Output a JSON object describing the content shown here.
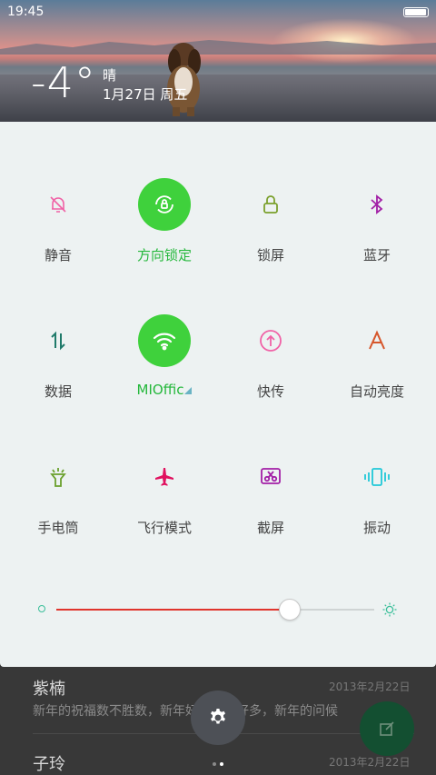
{
  "statusbar": {
    "time": "19:45",
    "battery_level": 0.95
  },
  "weather": {
    "temperature": "-4°",
    "condition": "晴",
    "date": "1月27日 周五"
  },
  "toggles": [
    {
      "label": "静音",
      "icon": "bell-mute-icon",
      "active": false,
      "color": "#f062a6"
    },
    {
      "label": "方向锁定",
      "icon": "rotation-lock-icon",
      "active": true,
      "color": "#ffffff"
    },
    {
      "label": "锁屏",
      "icon": "lock-icon",
      "active": false,
      "color": "#7aa02c"
    },
    {
      "label": "蓝牙",
      "icon": "bluetooth-icon",
      "active": false,
      "color": "#a21fa6"
    },
    {
      "label": "数据",
      "icon": "data-arrows-icon",
      "active": false,
      "color": "#1f7a6a"
    },
    {
      "label": "MIOffic",
      "icon": "wifi-icon",
      "active": true,
      "color": "#ffffff"
    },
    {
      "label": "快传",
      "icon": "upload-circle-icon",
      "active": false,
      "color": "#f062a6"
    },
    {
      "label": "自动亮度",
      "icon": "auto-brightness-icon",
      "active": false,
      "color": "#d6562b"
    },
    {
      "label": "手电筒",
      "icon": "flashlight-icon",
      "active": false,
      "color": "#6aa02c"
    },
    {
      "label": "飞行模式",
      "icon": "airplane-icon",
      "active": false,
      "color": "#e0115f"
    },
    {
      "label": "截屏",
      "icon": "screenshot-scissors-icon",
      "active": false,
      "color": "#a21fa6"
    },
    {
      "label": "振动",
      "icon": "vibrate-icon",
      "active": false,
      "color": "#20c8d8"
    }
  ],
  "brightness": {
    "value": 0.73,
    "track_color": "#e0352d"
  },
  "accent": {
    "active_bg": "#3fd13c",
    "active_label": "#25b83c"
  },
  "background_app": {
    "notes": [
      {
        "title": "紫楠",
        "date": "2013年2月22日",
        "body": "新年的祝福数不胜数，新年好多好多好多，新年的问候"
      },
      {
        "title": "子玲",
        "date": "2013年2月22日",
        "body": ""
      }
    ]
  },
  "pager": {
    "pages": 2,
    "current": 2
  }
}
